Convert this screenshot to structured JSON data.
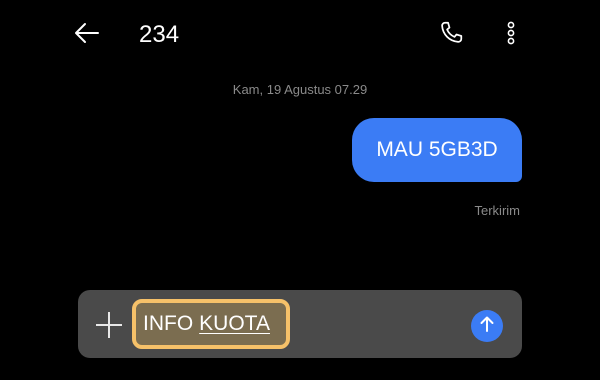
{
  "header": {
    "title": "234",
    "back_icon": "arrow-left-icon",
    "call_icon": "phone-icon",
    "menu_icon": "more-vertical-icon"
  },
  "conversation": {
    "date_stamp": "Kam, 19 Agustus 07.29",
    "messages": [
      {
        "direction": "outgoing",
        "text": "MAU 5GB3D",
        "status": "Terkirim"
      }
    ]
  },
  "composer": {
    "add_icon": "plus-icon",
    "input_value_part1": "INFO",
    "input_value_part2": "KUOTA",
    "send_icon": "arrow-up-icon"
  },
  "colors": {
    "background": "#000000",
    "bubble": "#3b7cf5",
    "composer": "#4a4a4a",
    "highlight_border": "#f6c169",
    "meta_text": "#8a8a8a"
  }
}
